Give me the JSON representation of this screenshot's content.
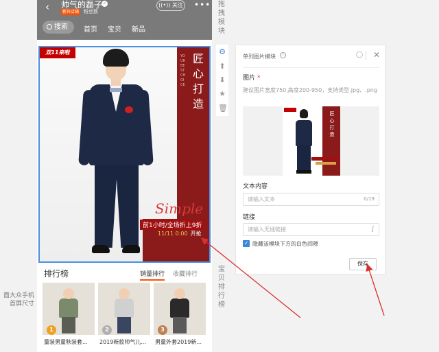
{
  "left_caption": "面大众手机\n首屏尺寸",
  "shop": {
    "back_icon": "back-arrow-icon",
    "name": "帅气的磊子",
    "new_badge": "新开店铺",
    "fans": "粉丝数",
    "follow": "关注",
    "more": "•••"
  },
  "nav": {
    "search": "搜索",
    "tabs": [
      "首页",
      "宝贝",
      "新品"
    ]
  },
  "hero": {
    "badge": "双11来啦",
    "vertical_title": "匠心打造",
    "vertical_small": "YOUR BEST CHOICE",
    "script": "Simple",
    "promo": "前1小时/全场折上9折",
    "date": "11/11 0:00",
    "date_suffix": "开抢"
  },
  "ranking": {
    "title": "排行榜",
    "tab_sales": "销量排行",
    "tab_fav": "收藏排行",
    "products": [
      {
        "rank": "1",
        "title": "童装男童秋装套...",
        "rank_color": "#f0a020",
        "top_color": "#7a8a6a",
        "bottom_color": "#5a5e52"
      },
      {
        "rank": "2",
        "title": "2019新款帅气儿...",
        "rank_color": "#b0b0b0",
        "top_color": "#d0d0d0",
        "bottom_color": "#3a4660"
      },
      {
        "rank": "3",
        "title": "男童外套2019新...",
        "rank_color": "#c08050",
        "top_color": "#2a2a2a",
        "bottom_color": "#5a5a5a"
      }
    ]
  },
  "side_labels": {
    "drag": "拖拽模块",
    "rank": "宝贝排行榜"
  },
  "tools": {
    "settings": "gear-icon",
    "up": "arrow-up-icon",
    "down": "arrow-down-icon",
    "star": "star-icon",
    "delete": "trash-icon"
  },
  "panel": {
    "title": "单列图片模块",
    "image_label": "图片",
    "required": "*",
    "image_hint": "建议图片宽度750,高度200-950，支持类型.jpg、.png",
    "text_label": "文本内容",
    "text_placeholder": "请输入文本",
    "text_counter": "0/19",
    "link_label": "链接",
    "link_placeholder": "请输入无线链接",
    "checkbox_label": "隐藏该模块下方的白色间隙",
    "checkbox_checked": true,
    "save": "保存"
  },
  "colors": {
    "accent": "#3a86d9",
    "brand_orange": "#ff5000",
    "hero_red": "#8b1a1a",
    "arrow_red": "#d93030"
  }
}
